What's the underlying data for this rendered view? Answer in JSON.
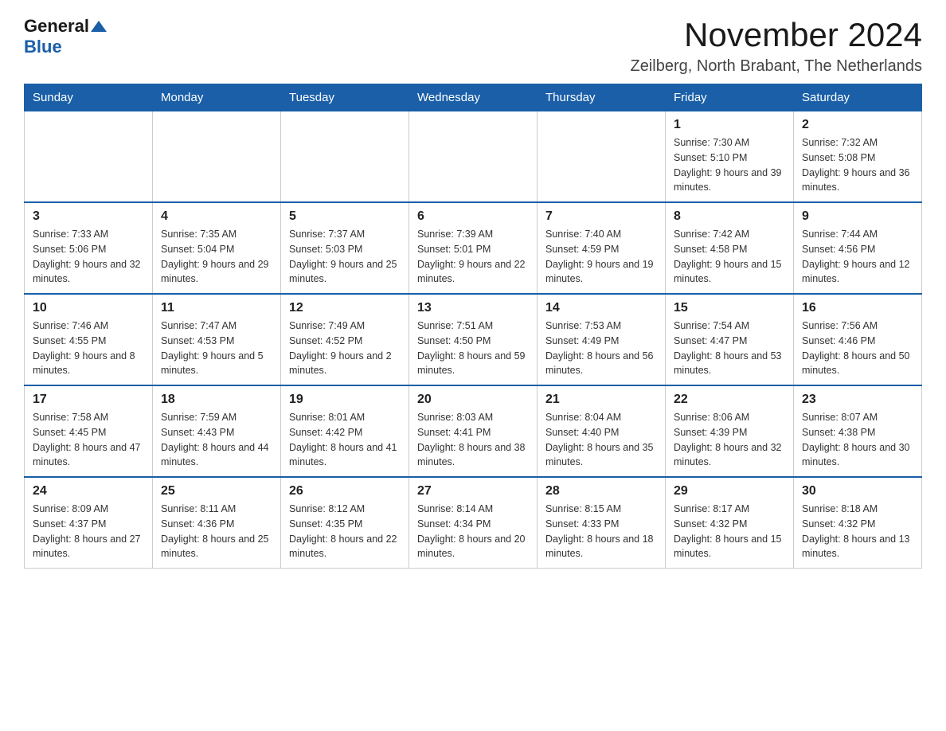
{
  "logo": {
    "general": "General",
    "blue": "Blue"
  },
  "title": "November 2024",
  "location": "Zeilberg, North Brabant, The Netherlands",
  "weekdays": [
    "Sunday",
    "Monday",
    "Tuesday",
    "Wednesday",
    "Thursday",
    "Friday",
    "Saturday"
  ],
  "weeks": [
    [
      {
        "day": "",
        "info": ""
      },
      {
        "day": "",
        "info": ""
      },
      {
        "day": "",
        "info": ""
      },
      {
        "day": "",
        "info": ""
      },
      {
        "day": "",
        "info": ""
      },
      {
        "day": "1",
        "info": "Sunrise: 7:30 AM\nSunset: 5:10 PM\nDaylight: 9 hours and 39 minutes."
      },
      {
        "day": "2",
        "info": "Sunrise: 7:32 AM\nSunset: 5:08 PM\nDaylight: 9 hours and 36 minutes."
      }
    ],
    [
      {
        "day": "3",
        "info": "Sunrise: 7:33 AM\nSunset: 5:06 PM\nDaylight: 9 hours and 32 minutes."
      },
      {
        "day": "4",
        "info": "Sunrise: 7:35 AM\nSunset: 5:04 PM\nDaylight: 9 hours and 29 minutes."
      },
      {
        "day": "5",
        "info": "Sunrise: 7:37 AM\nSunset: 5:03 PM\nDaylight: 9 hours and 25 minutes."
      },
      {
        "day": "6",
        "info": "Sunrise: 7:39 AM\nSunset: 5:01 PM\nDaylight: 9 hours and 22 minutes."
      },
      {
        "day": "7",
        "info": "Sunrise: 7:40 AM\nSunset: 4:59 PM\nDaylight: 9 hours and 19 minutes."
      },
      {
        "day": "8",
        "info": "Sunrise: 7:42 AM\nSunset: 4:58 PM\nDaylight: 9 hours and 15 minutes."
      },
      {
        "day": "9",
        "info": "Sunrise: 7:44 AM\nSunset: 4:56 PM\nDaylight: 9 hours and 12 minutes."
      }
    ],
    [
      {
        "day": "10",
        "info": "Sunrise: 7:46 AM\nSunset: 4:55 PM\nDaylight: 9 hours and 8 minutes."
      },
      {
        "day": "11",
        "info": "Sunrise: 7:47 AM\nSunset: 4:53 PM\nDaylight: 9 hours and 5 minutes."
      },
      {
        "day": "12",
        "info": "Sunrise: 7:49 AM\nSunset: 4:52 PM\nDaylight: 9 hours and 2 minutes."
      },
      {
        "day": "13",
        "info": "Sunrise: 7:51 AM\nSunset: 4:50 PM\nDaylight: 8 hours and 59 minutes."
      },
      {
        "day": "14",
        "info": "Sunrise: 7:53 AM\nSunset: 4:49 PM\nDaylight: 8 hours and 56 minutes."
      },
      {
        "day": "15",
        "info": "Sunrise: 7:54 AM\nSunset: 4:47 PM\nDaylight: 8 hours and 53 minutes."
      },
      {
        "day": "16",
        "info": "Sunrise: 7:56 AM\nSunset: 4:46 PM\nDaylight: 8 hours and 50 minutes."
      }
    ],
    [
      {
        "day": "17",
        "info": "Sunrise: 7:58 AM\nSunset: 4:45 PM\nDaylight: 8 hours and 47 minutes."
      },
      {
        "day": "18",
        "info": "Sunrise: 7:59 AM\nSunset: 4:43 PM\nDaylight: 8 hours and 44 minutes."
      },
      {
        "day": "19",
        "info": "Sunrise: 8:01 AM\nSunset: 4:42 PM\nDaylight: 8 hours and 41 minutes."
      },
      {
        "day": "20",
        "info": "Sunrise: 8:03 AM\nSunset: 4:41 PM\nDaylight: 8 hours and 38 minutes."
      },
      {
        "day": "21",
        "info": "Sunrise: 8:04 AM\nSunset: 4:40 PM\nDaylight: 8 hours and 35 minutes."
      },
      {
        "day": "22",
        "info": "Sunrise: 8:06 AM\nSunset: 4:39 PM\nDaylight: 8 hours and 32 minutes."
      },
      {
        "day": "23",
        "info": "Sunrise: 8:07 AM\nSunset: 4:38 PM\nDaylight: 8 hours and 30 minutes."
      }
    ],
    [
      {
        "day": "24",
        "info": "Sunrise: 8:09 AM\nSunset: 4:37 PM\nDaylight: 8 hours and 27 minutes."
      },
      {
        "day": "25",
        "info": "Sunrise: 8:11 AM\nSunset: 4:36 PM\nDaylight: 8 hours and 25 minutes."
      },
      {
        "day": "26",
        "info": "Sunrise: 8:12 AM\nSunset: 4:35 PM\nDaylight: 8 hours and 22 minutes."
      },
      {
        "day": "27",
        "info": "Sunrise: 8:14 AM\nSunset: 4:34 PM\nDaylight: 8 hours and 20 minutes."
      },
      {
        "day": "28",
        "info": "Sunrise: 8:15 AM\nSunset: 4:33 PM\nDaylight: 8 hours and 18 minutes."
      },
      {
        "day": "29",
        "info": "Sunrise: 8:17 AM\nSunset: 4:32 PM\nDaylight: 8 hours and 15 minutes."
      },
      {
        "day": "30",
        "info": "Sunrise: 8:18 AM\nSunset: 4:32 PM\nDaylight: 8 hours and 13 minutes."
      }
    ]
  ]
}
